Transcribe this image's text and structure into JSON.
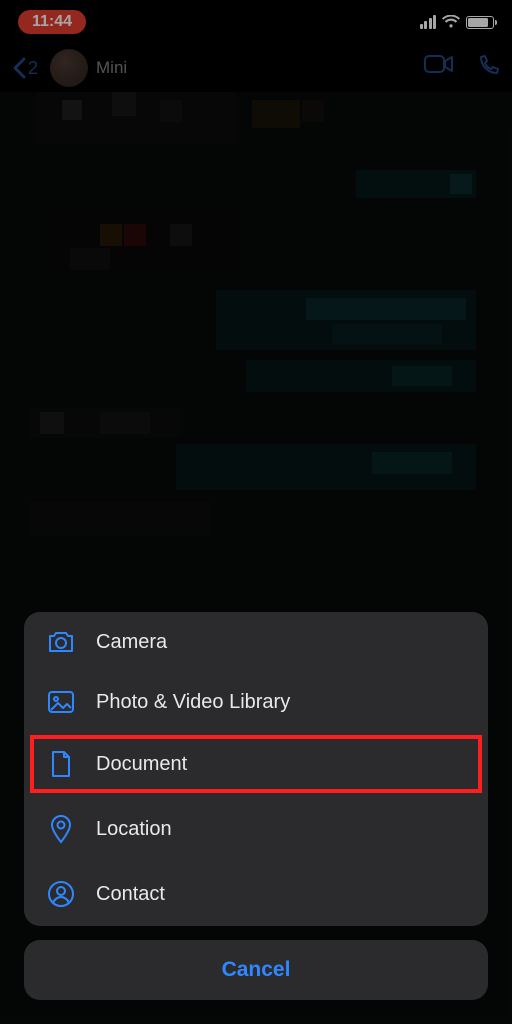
{
  "status": {
    "time": "11:44"
  },
  "header": {
    "back_count": "2",
    "contact_name": "Mini"
  },
  "sheet": {
    "items": [
      {
        "label": "Camera",
        "icon": "camera-icon",
        "highlighted": false
      },
      {
        "label": "Photo & Video Library",
        "icon": "photo-library-icon",
        "highlighted": false
      },
      {
        "label": "Document",
        "icon": "document-icon",
        "highlighted": true
      },
      {
        "label": "Location",
        "icon": "location-pin-icon",
        "highlighted": false
      },
      {
        "label": "Contact",
        "icon": "contact-person-icon",
        "highlighted": false
      }
    ],
    "cancel_label": "Cancel"
  }
}
